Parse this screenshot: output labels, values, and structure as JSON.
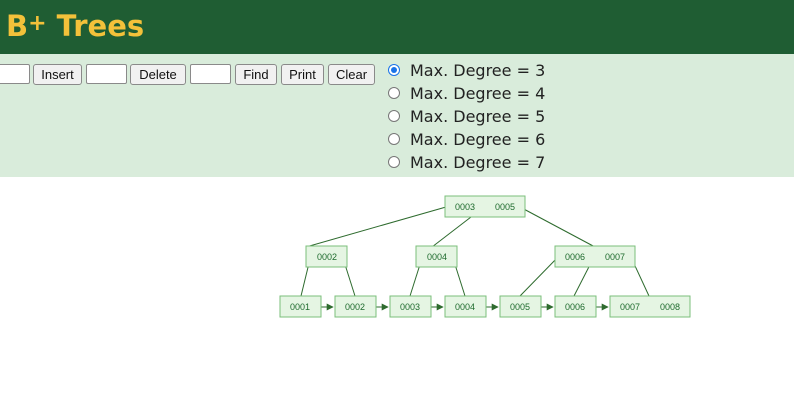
{
  "header": {
    "title": "B",
    "title_sup": "+",
    "title_rest": "Trees"
  },
  "controls": {
    "insert_label": "Insert",
    "delete_label": "Delete",
    "find_label": "Find",
    "print_label": "Print",
    "clear_label": "Clear",
    "insert_value": "",
    "delete_value": "",
    "find_value": ""
  },
  "degree_options": [
    {
      "label": "Max. Degree = 3",
      "checked": true
    },
    {
      "label": "Max. Degree = 4",
      "checked": false
    },
    {
      "label": "Max. Degree = 5",
      "checked": false
    },
    {
      "label": "Max. Degree = 6",
      "checked": false
    },
    {
      "label": "Max. Degree = 7",
      "checked": false
    }
  ],
  "tree": {
    "root": [
      "0003",
      "0005"
    ],
    "internal": [
      [
        "0002"
      ],
      [
        "0004"
      ],
      [
        "0006",
        "0007"
      ]
    ],
    "leaves": [
      [
        "0001"
      ],
      [
        "0002"
      ],
      [
        "0003"
      ],
      [
        "0004"
      ],
      [
        "0005"
      ],
      [
        "0006"
      ],
      [
        "0007",
        "0008"
      ]
    ],
    "colors": {
      "node_fill": "#e5f5e3",
      "node_stroke": "#7bbf7b",
      "edge": "#2e6b2e",
      "text": "#1f6b2e"
    }
  }
}
